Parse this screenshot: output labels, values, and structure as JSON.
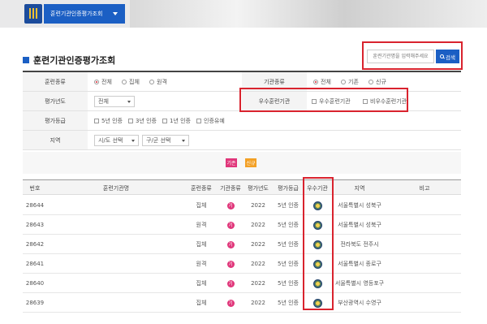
{
  "header": {
    "nav_label": "훈련기관인증평가조회"
  },
  "page": {
    "title": "훈련기관인증평가조회"
  },
  "search": {
    "placeholder": "훈련기관명을 입력해주세요",
    "button_label": "검색"
  },
  "filters": {
    "training_type": {
      "label": "훈련종류",
      "options": [
        "전체",
        "집체",
        "원격"
      ],
      "selected": "전체"
    },
    "institution_type": {
      "label": "기관종류",
      "options": [
        "전체",
        "기존",
        "신규"
      ],
      "selected": "전체"
    },
    "eval_year": {
      "label": "평가년도",
      "value": "전체"
    },
    "excellent": {
      "label": "우수훈련기관",
      "options": [
        "우수훈련기관",
        "비우수훈련기관"
      ]
    },
    "eval_grade": {
      "label": "평가등급",
      "options": [
        "5년 인증",
        "3년 인증",
        "1년 인증",
        "인증유예"
      ]
    },
    "region": {
      "label": "지역",
      "sido": "시/도 선택",
      "gugun": "구/군 선택"
    }
  },
  "band_buttons": {
    "left": "기존",
    "right": "신규"
  },
  "table": {
    "headers": [
      "번호",
      "훈련기관명",
      "훈련종류",
      "기관종류",
      "평가년도",
      "평가등급",
      "우수기관",
      "지역",
      "비고"
    ],
    "rows": [
      {
        "no": "28644",
        "name": "",
        "type": "집체",
        "inst": "기",
        "year": "2022",
        "grade": "5년 인증",
        "region": "서울특별시 성북구"
      },
      {
        "no": "28643",
        "name": "",
        "type": "원격",
        "inst": "기",
        "year": "2022",
        "grade": "5년 인증",
        "region": "서울특별시 성북구"
      },
      {
        "no": "28642",
        "name": "",
        "type": "집체",
        "inst": "기",
        "year": "2022",
        "grade": "5년 인증",
        "region": "전라북도 전주시"
      },
      {
        "no": "28641",
        "name": "",
        "type": "원격",
        "inst": "기",
        "year": "2022",
        "grade": "5년 인증",
        "region": "서울특별시 종로구"
      },
      {
        "no": "28640",
        "name": "",
        "type": "집체",
        "inst": "기",
        "year": "2022",
        "grade": "5년 인증",
        "region": "서울특별시 영등포구"
      },
      {
        "no": "28639",
        "name": "",
        "type": "집체",
        "inst": "기",
        "year": "2022",
        "grade": "5년 인증",
        "region": "부산광역시 수영구"
      }
    ]
  },
  "colors": {
    "accent": "#1b5fc4",
    "highlight": "#d9232e",
    "badge": "#e0367a",
    "band_btn_left": "#e0367a",
    "band_btn_right": "#f3a025"
  }
}
